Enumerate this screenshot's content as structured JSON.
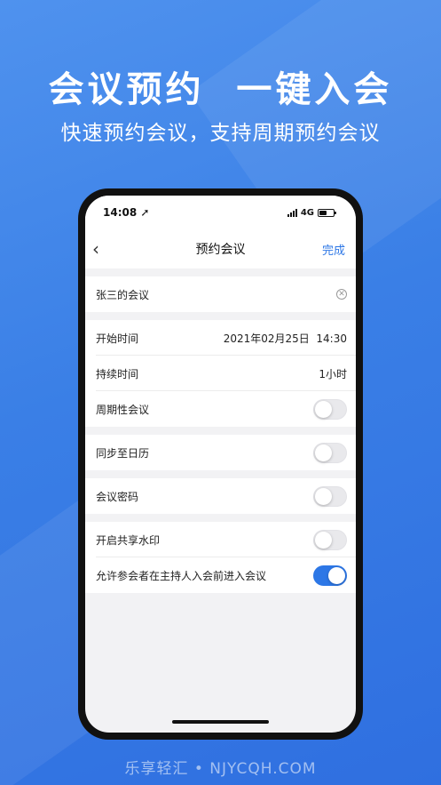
{
  "promo": {
    "headline": "会议预约  一键入会",
    "subline": "快速预约会议，支持周期预约会议"
  },
  "status_bar": {
    "time": "14:08 ➚",
    "network": "4G"
  },
  "nav": {
    "back_icon": "chevron-left-icon",
    "title": "预约会议",
    "done_label": "完成"
  },
  "meeting": {
    "topic": "张三的会议"
  },
  "rows": {
    "start_time": {
      "label": "开始时间",
      "value": "2021年02月25日  14:30"
    },
    "duration": {
      "label": "持续时间",
      "value": "1小时"
    },
    "recurring": {
      "label": "周期性会议",
      "on": false
    },
    "sync_calendar": {
      "label": "同步至日历",
      "on": false
    },
    "password": {
      "label": "会议密码",
      "on": false
    },
    "watermark": {
      "label": "开启共享水印",
      "on": false
    },
    "join_before_host": {
      "label": "允许参会者在主持人入会前进入会议",
      "on": true
    }
  },
  "footer_watermark": "乐享轻汇 • NJYCQH.COM",
  "colors": {
    "accent": "#2d77e6",
    "background": "#3a7fe6"
  }
}
